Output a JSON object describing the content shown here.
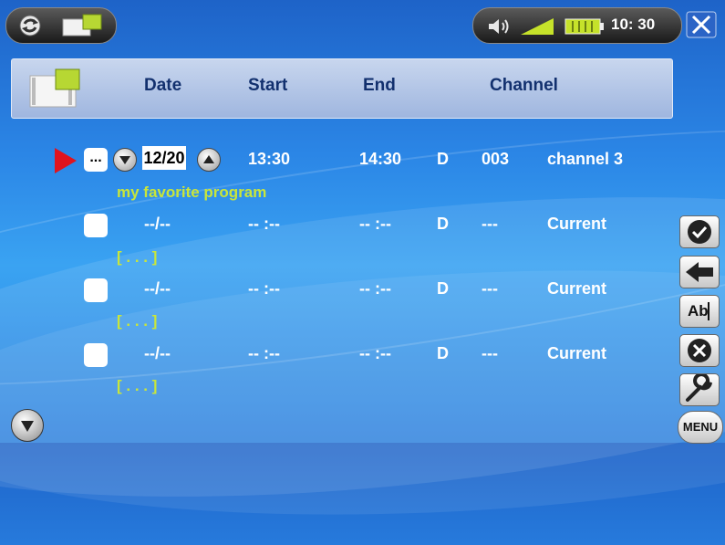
{
  "status": {
    "clock": "10: 30"
  },
  "columns": {
    "date": "Date",
    "start": "Start",
    "end": "End",
    "channel": "Channel"
  },
  "rows": [
    {
      "date": "12/20",
      "start": "13:30",
      "end": "14:30",
      "mode": "D",
      "num": "003",
      "channel": "channel 3",
      "name": "my favorite program",
      "more": "..."
    },
    {
      "date": "--/--",
      "start": "-- :--",
      "end": "-- :--",
      "mode": "D",
      "num": "---",
      "channel": "Current",
      "name": "[ . . . ]"
    },
    {
      "date": "--/--",
      "start": "-- :--",
      "end": "-- :--",
      "mode": "D",
      "num": "---",
      "channel": "Current",
      "name": "[ . . . ]"
    },
    {
      "date": "--/--",
      "start": "-- :--",
      "end": "-- :--",
      "mode": "D",
      "num": "---",
      "channel": "Current",
      "name": "[ . . . ]"
    }
  ],
  "side": {
    "rename_label": "Ab",
    "menu_label": "MENU"
  },
  "icons": {
    "refresh": "refresh-icon",
    "calendar": "calendar-icon",
    "volume": "volume-icon",
    "signal": "signal-icon",
    "battery": "battery-icon",
    "close": "close-icon",
    "check": "check-icon",
    "back": "arrow-left-icon",
    "cancel": "cancel-icon",
    "settings": "wrench-icon"
  },
  "colors": {
    "accent": "#c9e63a",
    "header_text": "#12306e",
    "selector": "#e0141e"
  }
}
